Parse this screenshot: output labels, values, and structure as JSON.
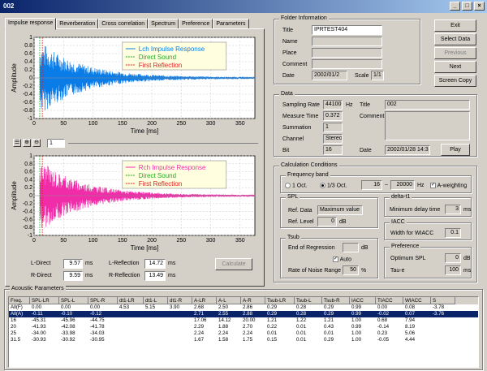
{
  "window": {
    "title": "002"
  },
  "tabs": [
    "Impulse response",
    "Reverberation",
    "Cross correlation",
    "Spectrum",
    "Preference",
    "Parameters"
  ],
  "charts": {
    "ylabel": "Amplitude",
    "xlabel": "Time [ms]",
    "yticks": [
      "1",
      "0.8",
      "0.6",
      "0.4",
      "0.2",
      "0",
      "-0.2",
      "-0.4",
      "-0.6",
      "-0.8",
      "-1"
    ],
    "xticks": [
      "0",
      "50",
      "100",
      "150",
      "200",
      "250",
      "300",
      "350"
    ],
    "top": {
      "legend": [
        "Lch Impulse Response",
        "Direct Sound",
        "First Reflection"
      ],
      "color": "#0a7ce8"
    },
    "bottom": {
      "legend": [
        "Rch Impulse Response",
        "Direct Sound",
        "First Reflection"
      ],
      "color": "#f02ca8"
    },
    "toolbar_value": "1"
  },
  "chart_data": [
    {
      "type": "line",
      "series": [
        {
          "name": "Lch Impulse Response"
        },
        {
          "name": "Direct Sound"
        },
        {
          "name": "First Reflection"
        }
      ],
      "xlabel": "Time [ms]",
      "ylabel": "Amplitude",
      "xlim": [
        0,
        375
      ],
      "ylim": [
        -1,
        1
      ]
    },
    {
      "type": "line",
      "series": [
        {
          "name": "Rch Impulse Response"
        },
        {
          "name": "Direct Sound"
        },
        {
          "name": "First Reflection"
        }
      ],
      "xlabel": "Time [ms]",
      "ylabel": "Amplitude",
      "xlim": [
        0,
        375
      ],
      "ylim": [
        -1,
        1
      ]
    }
  ],
  "direct": {
    "l_label": "L-Direct",
    "l_value": "9.57",
    "r_label": "R-Direct",
    "r_value": "9.59",
    "unit": "ms"
  },
  "reflection": {
    "l_label": "L-Reflection",
    "l_value": "14.72",
    "r_label": "R-Reflection",
    "r_value": "13.49",
    "unit": "ms"
  },
  "calculate_label": "Calculate",
  "folder": {
    "title": "Folder Information",
    "title_label": "Title",
    "title_value": "IPRTEST404",
    "name_label": "Name",
    "place_label": "Place",
    "comment_label": "Comment",
    "date_label": "Date",
    "date_value": "2002/01/2",
    "scale_label": "Scale",
    "scale_value": "1/1"
  },
  "buttons": [
    "Exit",
    "Select Data",
    "Previous",
    "Next",
    "Screen Copy"
  ],
  "data": {
    "title": "Data",
    "sr_label": "Sampling Rate",
    "sr_value": "44100",
    "mt_label": "Measure Time",
    "mt_value": "0.372",
    "sum_label": "Summation",
    "sum_value": "1",
    "ch_label": "Channel",
    "ch_value": "Stereo",
    "bit_label": "Bit",
    "bit_value": "16",
    "t_label": "Title",
    "t_value": "002",
    "c_label": "Comment",
    "hz": "Hz",
    "date_label": "Date",
    "date_value": "2002/01/28 14:3",
    "play_label": "Play"
  },
  "calc": {
    "title": "Calculation Conditions",
    "fb_title": "Frequency band",
    "oct1": "1 Oct.",
    "oct3": "1/3 Oct.",
    "f_low": "16",
    "tilde": "~",
    "f_high": "20000",
    "hz": "Hz",
    "aweight": "A-weighting",
    "spl_title": "SPL",
    "ref_data_label": "Ref. Data",
    "ref_data_value": "Maximum value",
    "ref_level_label": "Ref. Level",
    "ref_level_value": "0",
    "db": "dB",
    "dt1_title": "delta-t1",
    "min_delay_label": "Minimum delay time",
    "min_delay_value": "3",
    "ms": "ms",
    "iacc_title": "IACC",
    "wiacc_label": "Width for WIACC",
    "wiacc_value": "0.1",
    "tsub_title": "Tsub",
    "eor_label": "End of Regression",
    "auto_label": "Auto",
    "rnr_label": "Rate of Noise Range",
    "rnr_value": "50",
    "pct": "%",
    "pref_title": "Preference",
    "opt_label": "Optimum SPL",
    "opt_value": "0",
    "taue_label": "Tau-e",
    "taue_value": "100"
  },
  "acoustic": {
    "title": "Acoustic Parameters",
    "headers": [
      "Freq.",
      "SPL-LR",
      "SPL-L",
      "SPL-R",
      "dt1-LR",
      "dt1-L",
      "dt1-R",
      "A-LR",
      "A-L",
      "A-R",
      "Tsub-LR",
      "Tsub-L",
      "Tsub-R",
      "IACC",
      "TIACC",
      "WIACC",
      "S"
    ],
    "rows": [
      [
        "All(F)",
        "0.00",
        "0.00",
        "0.00",
        "4.53",
        "5.15",
        "3.90",
        "2.68",
        "2.50",
        "2.86",
        "0.29",
        "0.28",
        "0.29",
        "0.99",
        "0.00",
        "0.08",
        "-3.78"
      ],
      [
        "All(A)",
        "-0.11",
        "-0.10",
        "-0.12",
        "",
        "",
        "",
        "2.71",
        "2.55",
        "2.88",
        "0.29",
        "0.28",
        "0.29",
        "0.99",
        "-0.02",
        "0.07",
        "-3.76"
      ],
      [
        "16",
        "-45.31",
        "-45.96",
        "-44.75",
        "",
        "",
        "",
        "17.06",
        "14.12",
        "20.00",
        "1.21",
        "1.22",
        "1.21",
        "1.00",
        "0.68",
        "7.94",
        ""
      ],
      [
        "20",
        "-41.93",
        "-42.08",
        "-41.78",
        "",
        "",
        "",
        "2.29",
        "1.88",
        "2.70",
        "0.22",
        "0.01",
        "0.43",
        "0.99",
        "-0.14",
        "8.19",
        ""
      ],
      [
        "25",
        "-34.00",
        "-33.98",
        "-34.03",
        "",
        "",
        "",
        "2.24",
        "2.24",
        "2.24",
        "0.01",
        "0.01",
        "0.01",
        "1.00",
        "0.23",
        "5.06",
        ""
      ],
      [
        "31.5",
        "-30.93",
        "-30.92",
        "-30.95",
        "",
        "",
        "",
        "1.67",
        "1.58",
        "1.75",
        "0.15",
        "0.01",
        "0.29",
        "1.00",
        "-0.05",
        "4.44",
        ""
      ]
    ]
  }
}
